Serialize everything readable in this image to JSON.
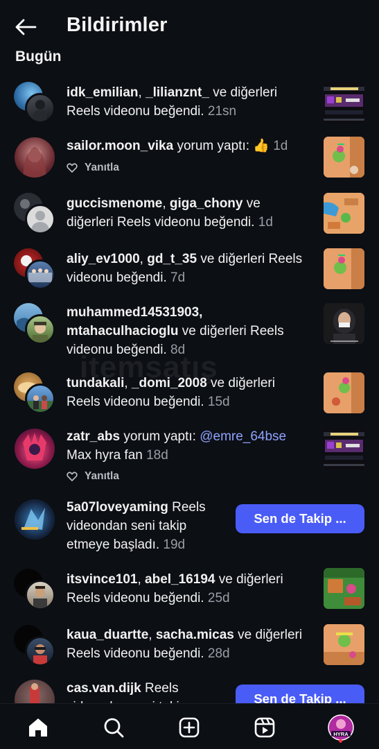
{
  "header": {
    "title": "Bildirimler",
    "back_icon": "back-arrow-icon"
  },
  "section": {
    "title": "Bugün"
  },
  "watermark": "itemsatış",
  "notifications": [
    {
      "user1": "idk_emilian",
      "sep": ", ",
      "user2": "_lilianznt_",
      "rest": " ve diğerleri Reels videonu beğendi.",
      "time": "21sn"
    },
    {
      "user1": "sailor.moon_vika",
      "rest": " yorum yaptı: 👍",
      "time": "1d",
      "reply": "Yanıtla"
    },
    {
      "user1": "guccismenome",
      "sep": ", ",
      "user2": "giga_chony",
      "rest": " ve diğerleri Reels videonu beğendi.",
      "time": "1d"
    },
    {
      "user1": "aliy_ev1000",
      "sep": ", ",
      "user2": "gd_t_35",
      "rest": " ve diğerleri Reels videonu beğendi.",
      "time": "7d"
    },
    {
      "user1": "muhammed14531903,",
      "user2": "mtahaculhacioglu",
      "rest": " ve diğerleri Reels videonu beğendi.",
      "time": "8d"
    },
    {
      "user1": "tundakali",
      "sep": ", ",
      "user2": "_domi_2008",
      "rest": " ve diğerleri Reels videonu beğendi.",
      "time": "15d"
    },
    {
      "user1": "zatr_abs",
      "rest": " yorum yaptı: ",
      "mention": "@emre_64bse",
      "rest2": " Max hyra fan",
      "time": "18d",
      "reply": "Yanıtla"
    },
    {
      "user1": "5a07loveyaming",
      "rest": " Reels videondan seni takip etmeye başladı.",
      "time": "19d",
      "button": "Sen de Takip ..."
    },
    {
      "user1": "itsvince101",
      "sep": ", ",
      "user2": "abel_16194",
      "rest": " ve diğerleri Reels videonu beğendi.",
      "time": "25d"
    },
    {
      "user1": "kaua_duartte",
      "sep": ", ",
      "user2": "sacha.micas",
      "rest": " ve diğerleri Reels videonu beğendi.",
      "time": "28d"
    },
    {
      "user1": "cas.van.dijk",
      "rest": " Reels videondan seni takip",
      "button": "Sen de Takip ..."
    }
  ],
  "nav": {
    "items": [
      "home-icon",
      "search-icon",
      "create-icon",
      "reels-icon",
      "profile-avatar"
    ],
    "profile_text": "HYRA"
  },
  "colors": {
    "background": "#0c0f14",
    "accent": "#4a5cf6",
    "mention": "#8fa3ff",
    "notification_dot": "#ff3040"
  }
}
